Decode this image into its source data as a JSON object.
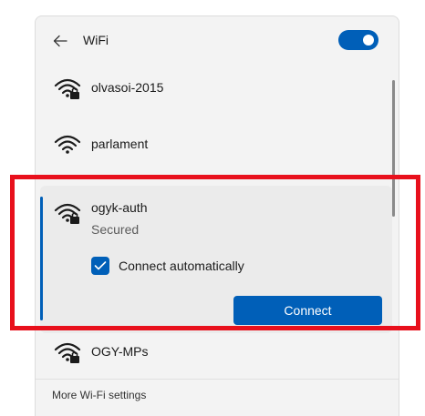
{
  "header": {
    "title": "WiFi",
    "back_icon": "back-arrow-icon",
    "toggle_on": true
  },
  "networks": [
    {
      "name": "olvasoi-2015",
      "icon": "wifi-secured-icon"
    },
    {
      "name": "parlament",
      "icon": "wifi-open-icon"
    },
    {
      "name": "ogyk-auth",
      "icon": "wifi-secured-icon",
      "status": "Secured",
      "auto_connect_label": "Connect automatically",
      "auto_connect_checked": true,
      "connect_label": "Connect"
    },
    {
      "name": "OGY-MPs",
      "icon": "wifi-secured-icon"
    }
  ],
  "footer": {
    "link": "More Wi-Fi settings"
  },
  "colors": {
    "accent": "#005fb8",
    "highlight": "#e8101c",
    "panel": "#f3f3f3"
  }
}
